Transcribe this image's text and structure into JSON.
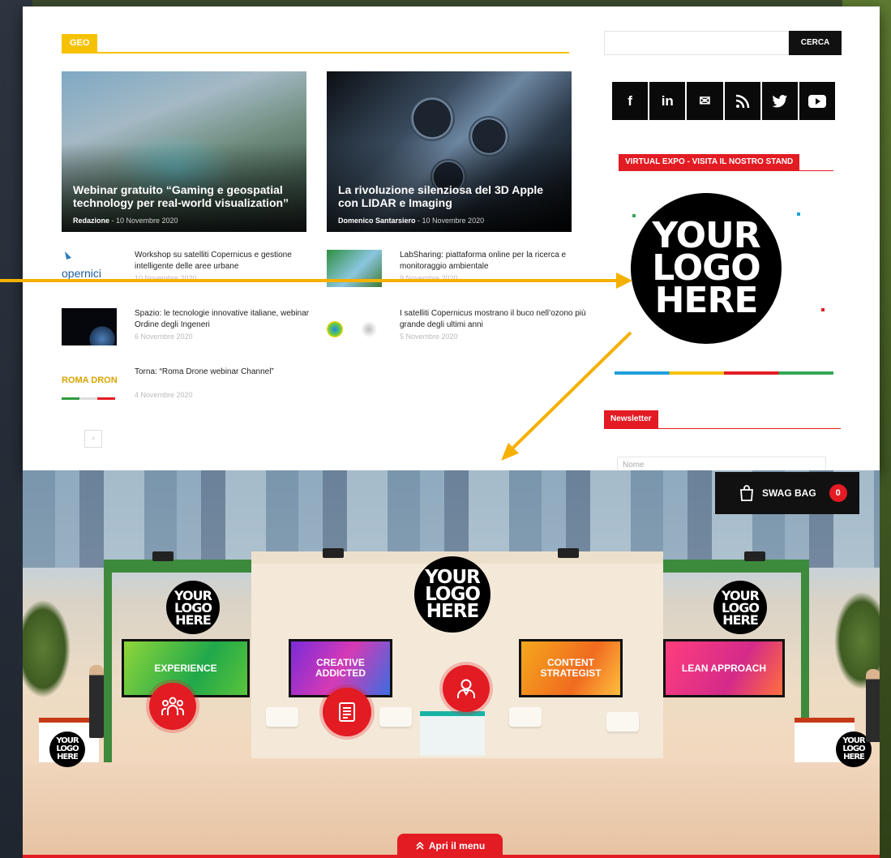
{
  "site": {
    "section_tag": "GEO",
    "features": [
      {
        "title": "Webinar gratuito “Gaming e geospatial technology per real-world visualization”",
        "author": "Redazione",
        "date": "10 Novembre 2020"
      },
      {
        "title": "La rivoluzione silenziosa del 3D Apple con LIDAR e Imaging",
        "author": "Domenico Santarsiero",
        "date": "10 Novembre 2020"
      }
    ],
    "posts": [
      {
        "title": "Workshop su satelliti Copernicus e gestione intelligente delle aree urbane",
        "date": "10 Novembre 2020",
        "thumb_text": "opernici"
      },
      {
        "title": "LabSharing: piattaforma online per la ricerca e monitoraggio ambientale",
        "date": "9 Novembre 2020"
      },
      {
        "title": "Spazio: le tecnologie innovative italiane, webinar Ordine degli Ingeneri",
        "date": "6 Novembre 2020"
      },
      {
        "title": "I satelliti Copernicus mostrano il buco nell’ozono più grande degli ultimi anni",
        "date": "5 Novembre 2020"
      },
      {
        "title": "Torna: “Roma Drone webinar Channel”",
        "date": "4 Novembre 2020",
        "thumb_text": "ROMA DRONE"
      }
    ],
    "pager_label": "›",
    "search_button": "CERCA",
    "social_icons": [
      "facebook-icon",
      "linkedin-icon",
      "mail-icon",
      "rss-icon",
      "twitter-icon",
      "youtube-icon"
    ],
    "social_glyphs": [
      "f",
      "in",
      "✉",
      "⟟",
      "🐦",
      "▶"
    ],
    "virtual_expo_label": "VIRTUAL EXPO - VISITA IL NOSTRO STAND",
    "logo_text": "YOUR\nLOGO\nHERE",
    "newsletter_label": "Newsletter",
    "name_placeholder": "Nome"
  },
  "stand": {
    "screens": [
      "EXPERIENCE",
      "CREATIVE\nADDICTED",
      "CONTENT\nSTRATEGIST",
      "LEAN APPROACH"
    ],
    "logo_text": "YOUR\nLOGO\nHERE",
    "swag_bag_label": "SWAG BAG",
    "swag_bag_count": "0",
    "menu_button": "Apri il menu",
    "menu_icon": "chevron-double-up-icon"
  },
  "colors": {
    "accent_red": "#e31b23",
    "geo_yellow": "#f6c200",
    "arrow_orange": "#f5b000"
  }
}
